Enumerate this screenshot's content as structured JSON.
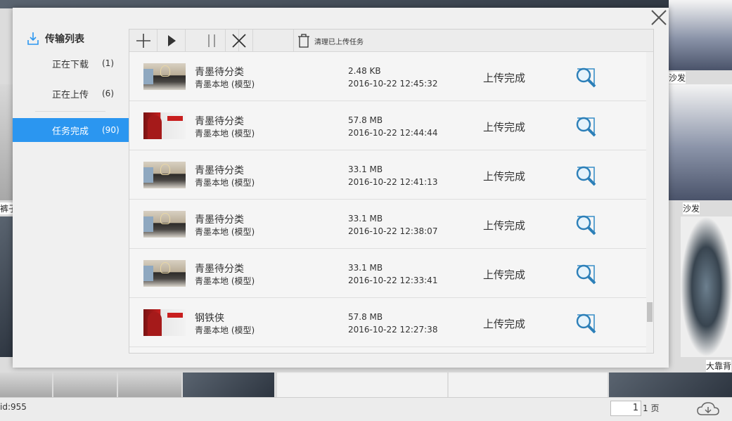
{
  "background": {
    "labels": [
      "沙发",
      "裤子",
      "沙发",
      "大靠背"
    ],
    "status_bar": {
      "id_text": "id:955",
      "page_value": "1",
      "page_total": "1 页"
    }
  },
  "dialog": {
    "sidebar": {
      "title": "传输列表",
      "items": [
        {
          "label": "正在下载",
          "count": "(1)"
        },
        {
          "label": "正在上传",
          "count": "(6)"
        },
        {
          "label": "任务完成",
          "count": "(90)"
        }
      ]
    },
    "toolbar": {
      "clear_label": "清理已上传任务"
    },
    "rows": [
      {
        "name": "青墨待分类",
        "source": "青墨本地 (模型)",
        "size": "2.48 KB",
        "time": "2016-10-22 12:45:32",
        "status": "上传完成",
        "thumb": "room"
      },
      {
        "name": "青墨待分类",
        "source": "青墨本地 (模型)",
        "size": "57.8 MB",
        "time": "2016-10-22 12:44:44",
        "status": "上传完成",
        "thumb": "deadpool"
      },
      {
        "name": "青墨待分类",
        "source": "青墨本地 (模型)",
        "size": "33.1 MB",
        "time": "2016-10-22 12:41:13",
        "status": "上传完成",
        "thumb": "room"
      },
      {
        "name": "青墨待分类",
        "source": "青墨本地 (模型)",
        "size": "33.1 MB",
        "time": "2016-10-22 12:38:07",
        "status": "上传完成",
        "thumb": "room"
      },
      {
        "name": "青墨待分类",
        "source": "青墨本地 (模型)",
        "size": "33.1 MB",
        "time": "2016-10-22 12:33:41",
        "status": "上传完成",
        "thumb": "room"
      },
      {
        "name": "钢铁侠",
        "source": "青墨本地 (模型)",
        "size": "57.8 MB",
        "time": "2016-10-22 12:27:38",
        "status": "上传完成",
        "thumb": "deadpool"
      }
    ],
    "accent_color": "#2b96f0"
  }
}
